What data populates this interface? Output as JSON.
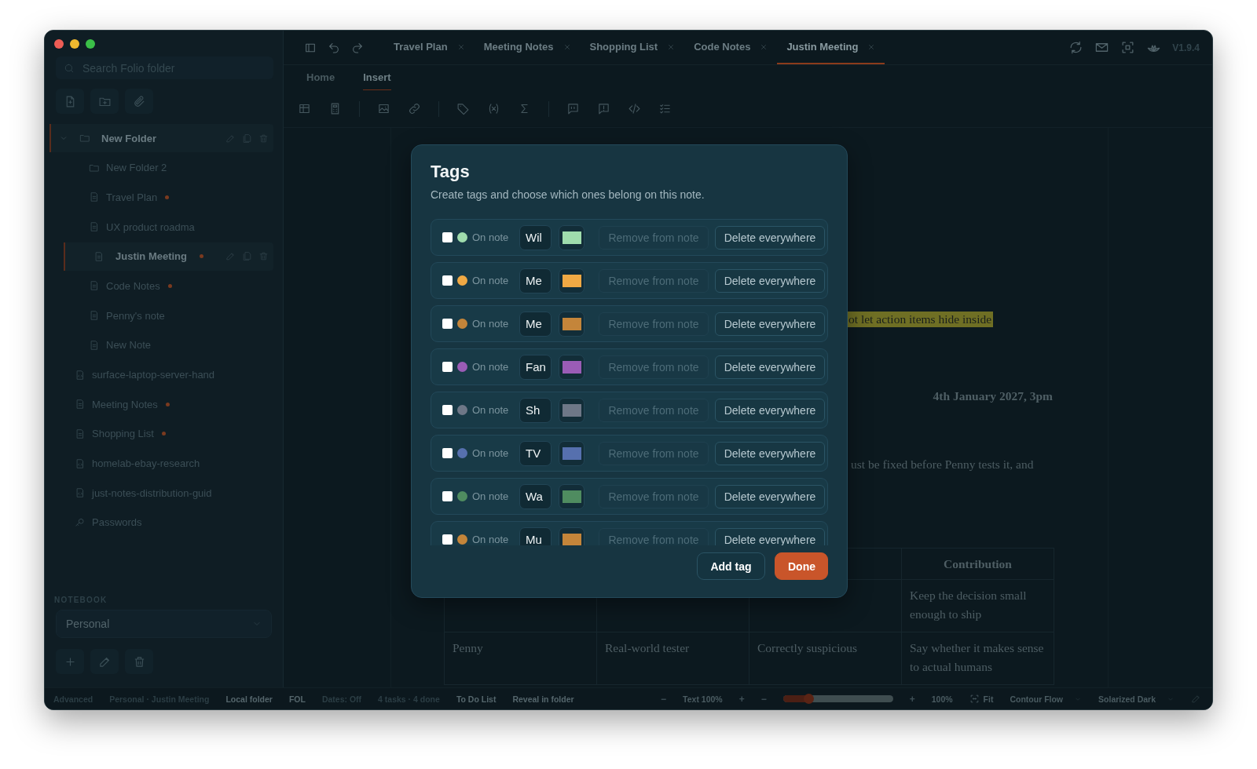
{
  "sidebar": {
    "search": {
      "placeholder": "Search Folio folder"
    },
    "tree": [
      {
        "kind": "folder",
        "label": "New Folder",
        "expanded": true,
        "selected": true,
        "modified": false,
        "children": [
          {
            "kind": "folder",
            "label": "New Folder 2",
            "selected": false,
            "modified": false
          },
          {
            "kind": "note",
            "label": "Travel Plan",
            "selected": false,
            "modified": true
          },
          {
            "kind": "note",
            "label": "UX product roadma",
            "selected": false,
            "modified": false
          },
          {
            "kind": "note",
            "label": "Justin Meeting",
            "selected": true,
            "modified": true
          },
          {
            "kind": "note",
            "label": "Code Notes",
            "selected": false,
            "modified": true
          },
          {
            "kind": "note",
            "label": "Penny's note",
            "selected": false,
            "modified": false
          },
          {
            "kind": "note",
            "label": "New Note",
            "selected": false,
            "modified": false
          }
        ]
      },
      {
        "kind": "document",
        "label": "surface-laptop-server-hand",
        "selected": false,
        "modified": false
      },
      {
        "kind": "note",
        "label": "Meeting Notes",
        "selected": false,
        "modified": true
      },
      {
        "kind": "note",
        "label": "Shopping List",
        "selected": false,
        "modified": true
      },
      {
        "kind": "document",
        "label": "homelab-ebay-research",
        "selected": false,
        "modified": false
      },
      {
        "kind": "document",
        "label": "just-notes-distribution-guid",
        "selected": false,
        "modified": false
      },
      {
        "kind": "vault",
        "label": "Passwords",
        "selected": false,
        "modified": false
      }
    ],
    "notebook": {
      "label": "NOTEBOOK",
      "value": "Personal"
    }
  },
  "tabs": [
    {
      "label": "Travel Plan",
      "selected": false
    },
    {
      "label": "Meeting Notes",
      "selected": false
    },
    {
      "label": "Shopping List",
      "selected": false
    },
    {
      "label": "Code Notes",
      "selected": false
    },
    {
      "label": "Justin Meeting",
      "selected": true
    }
  ],
  "version": "V1.9.4",
  "ribbon_tabs": [
    {
      "label": "Home",
      "selected": false
    },
    {
      "label": "Insert",
      "selected": true
    }
  ],
  "document": {
    "highlighted_text": "ot let action items hide inside",
    "date": "4th January 2027, 3pm",
    "paragraph": "ust be fixed before Penny tests it, and",
    "table": {
      "header": {
        "column_4": "Contribution"
      },
      "rows": [
        {
          "column_4": "Keep the decision small enough to ship"
        },
        {
          "column_1": "Penny",
          "column_2": "Real-world tester",
          "column_3": "Correctly suspicious",
          "column_4": "Say whether it makes sense to actual humans"
        }
      ]
    }
  },
  "dialog": {
    "title": "Tags",
    "subtitle": "Create tags and choose which ones belong on this note.",
    "tags": [
      {
        "checked": false,
        "color": "#9fdcad",
        "status": "On note",
        "name": "Wil",
        "remove": "Remove from note",
        "remove_disabled": true,
        "delete": "Delete everywhere"
      },
      {
        "checked": false,
        "color": "#f0a944",
        "status": "On note",
        "name": "Me",
        "remove": "Remove from note",
        "remove_disabled": true,
        "delete": "Delete everywhere"
      },
      {
        "checked": false,
        "color": "#c4853a",
        "status": "On note",
        "name": "Me",
        "remove": "Remove from note",
        "remove_disabled": true,
        "delete": "Delete everywhere"
      },
      {
        "checked": false,
        "color": "#9a5cb6",
        "status": "On note",
        "name": "Fan",
        "remove": "Remove from note",
        "remove_disabled": true,
        "delete": "Delete everywhere"
      },
      {
        "checked": false,
        "color": "#6e7787",
        "status": "On note",
        "name": "Sh",
        "remove": "Remove from note",
        "remove_disabled": true,
        "delete": "Delete everywhere"
      },
      {
        "checked": false,
        "color": "#5670ae",
        "status": "On note",
        "name": "TV",
        "remove": "Remove from note",
        "remove_disabled": true,
        "delete": "Delete everywhere"
      },
      {
        "checked": false,
        "color": "#4f8c60",
        "status": "On note",
        "name": "Wa",
        "remove": "Remove from note",
        "remove_disabled": true,
        "delete": "Delete everywhere"
      },
      {
        "checked": false,
        "color": "#c4853a",
        "status": "On note",
        "name": "Mu",
        "remove": "Remove from note",
        "remove_disabled": true,
        "delete": "Delete everywhere"
      }
    ],
    "buttons": [
      {
        "label": "Add tag",
        "kind": "secondary"
      },
      {
        "label": "Done",
        "kind": "primary"
      }
    ]
  },
  "status_bar": {
    "left": [
      {
        "text": "Advanced",
        "emphasis": false
      },
      {
        "text": "Personal · Justin Meeting",
        "emphasis": false
      },
      {
        "text": "Local folder",
        "emphasis": true
      },
      {
        "text": "FOL",
        "emphasis": true
      },
      {
        "text": "Dates: Off",
        "emphasis": false
      },
      {
        "text": "4 tasks · 4 done",
        "emphasis": false
      },
      {
        "text": "To Do List",
        "emphasis": true
      },
      {
        "text": "Reveal in folder",
        "emphasis": true
      }
    ],
    "right": [
      {
        "kind": "button",
        "text": "−"
      },
      {
        "kind": "text",
        "text": "Text 100%"
      },
      {
        "kind": "button",
        "text": "+"
      },
      {
        "kind": "button",
        "text": "−"
      },
      {
        "kind": "slider",
        "level": 0.23
      },
      {
        "kind": "button",
        "text": "+"
      },
      {
        "kind": "text",
        "text": "100%"
      },
      {
        "kind": "fit",
        "text": "Fit"
      },
      {
        "kind": "select",
        "text": "Contour Flow"
      },
      {
        "kind": "select",
        "text": "Solarized Dark"
      },
      {
        "kind": "edit"
      }
    ]
  }
}
